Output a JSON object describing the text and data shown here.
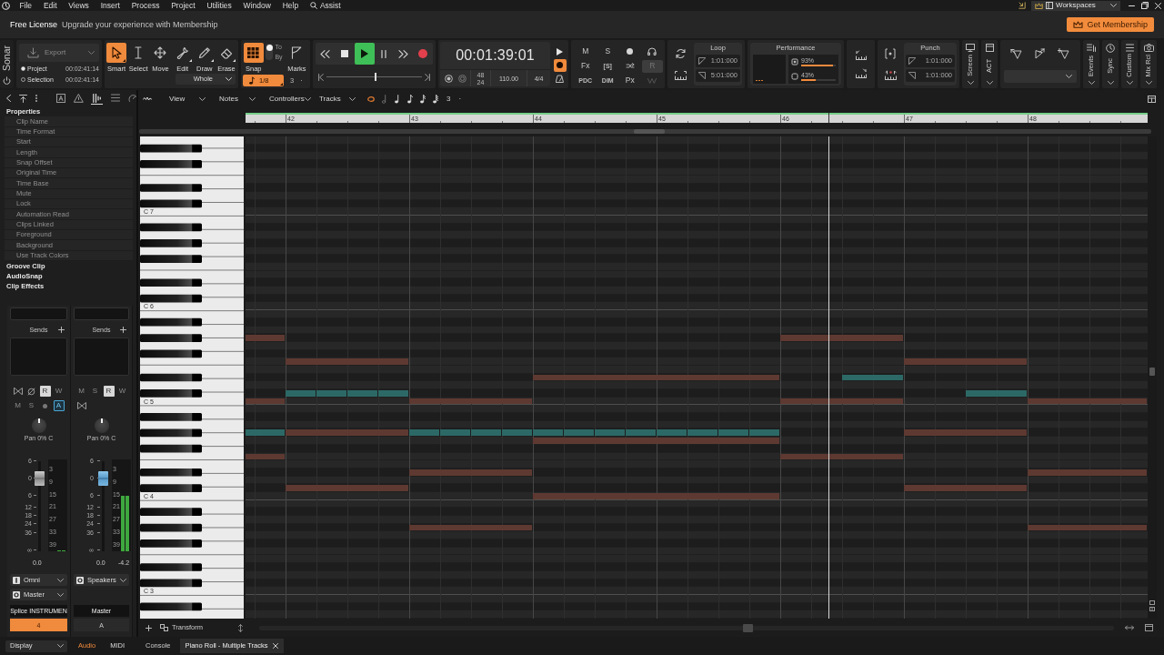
{
  "menubar": {
    "items": [
      "File",
      "Edit",
      "Views",
      "Insert",
      "Process",
      "Project",
      "Utilities",
      "Window",
      "Help"
    ],
    "assist": "Assist",
    "workspaces": "Workspaces"
  },
  "license": {
    "title": "Free License",
    "message": "Upgrade your experience with Membership",
    "button": "Get Membership"
  },
  "toolbar": {
    "logo": "Sonar",
    "export": {
      "label": "Export",
      "disabled": true,
      "options": [
        {
          "label": "Project",
          "time": "00:02:41:14",
          "selected": true
        },
        {
          "label": "Selection",
          "time": "00:02:41:14",
          "selected": false
        }
      ]
    },
    "tools": [
      {
        "kind": "smart",
        "label": "Smart",
        "selected": true,
        "has_menu": true
      },
      {
        "kind": "select",
        "label": "Select",
        "selected": false,
        "has_menu": false
      },
      {
        "kind": "move",
        "label": "Move",
        "selected": false,
        "has_menu": false
      },
      {
        "kind": "edit",
        "label": "Edit",
        "selected": false,
        "has_menu": true
      },
      {
        "kind": "draw",
        "label": "Draw",
        "selected": false,
        "has_menu": true
      },
      {
        "kind": "erase",
        "label": "Erase",
        "selected": false,
        "has_menu": true
      }
    ],
    "tool_mode": "Whole",
    "snap": {
      "label": "Snap",
      "on": true,
      "modes": [
        {
          "label": "To",
          "selected": true
        },
        {
          "label": "By",
          "selected": false
        }
      ],
      "marks": "Marks",
      "resolution": "1/8",
      "triplet": "3",
      "dotted": "·"
    },
    "transport": {
      "playing": true,
      "position": {
        "level": 0.51
      }
    },
    "clock": {
      "time": "00:01:39:01",
      "sample_rate": "48",
      "bit_depth": "24",
      "tempo": "110.00",
      "meter": "4/4",
      "record_mode": true
    },
    "mix_buttons": [
      {
        "label": "M",
        "on": false
      },
      {
        "label": "S",
        "on": false
      },
      {
        "label": "Fx",
        "on": false
      },
      {
        "label": "[S]",
        "on": false
      },
      {
        "label": "R",
        "on": true
      },
      {
        "label": "PDC",
        "on": false
      },
      {
        "label": "DIM",
        "on": false
      },
      {
        "label": "Px",
        "on": false
      }
    ],
    "loop": {
      "label": "Loop",
      "start": "1:01:000",
      "end": "5:01:000"
    },
    "performance": {
      "label": "Performance",
      "meters": [
        {
          "reading": "93%",
          "level": 0.93
        },
        {
          "reading": "43%",
          "level": 0.43
        }
      ]
    },
    "punch": {
      "label": "Punch",
      "start": "1:01:000",
      "end": "1:01:000"
    },
    "views_left": [
      "Screen",
      "ACT"
    ],
    "views_right": [
      "Events",
      "Sync",
      "Custom",
      "Mix Rcl"
    ]
  },
  "inspector": {
    "tabs": [
      {
        "selected": false
      },
      {
        "selected": false
      },
      {
        "selected": true
      },
      {
        "selected": false
      },
      {
        "selected": false
      }
    ],
    "title": "Properties",
    "properties": [
      "Clip Name",
      "Time Format",
      "Start",
      "Length",
      "Snap Offset",
      "Original Time",
      "Time Base",
      "Mute",
      "Lock",
      "Automation Read",
      "Clips Linked",
      "Foreground",
      "Background",
      "Use Track Colors"
    ],
    "sections": [
      "Groove Clip",
      "AudioSnap",
      "Clip Effects"
    ]
  },
  "strips": [
    {
      "kind": "track",
      "sends": "Sends",
      "buttons": [
        {
          "kind": "read",
          "label": "R",
          "on": true
        },
        {
          "kind": "write",
          "label": "W",
          "on": false
        },
        {
          "kind": "mute",
          "label": "M",
          "on": false
        },
        {
          "kind": "solo",
          "label": "S",
          "on": false
        },
        {
          "kind": "automation",
          "label": "A",
          "on": true
        }
      ],
      "pan": {
        "reading": "Pan 0% C",
        "level": 0.5
      },
      "fader": {
        "level": 0.81
      },
      "fader_scale": [
        "6",
        "0",
        "6",
        "12",
        "18",
        "24",
        "36",
        "∞"
      ],
      "meter_scale": [
        "3",
        "9",
        "15",
        "21",
        "27",
        "33",
        "39"
      ],
      "meters": [
        {
          "level": 0
        },
        {
          "level": 0
        }
      ],
      "fader_value": "0.0",
      "input": "Omni",
      "output": "Master",
      "name": "Splice INSTRUMEN",
      "number": "4",
      "color": "#f08a3c"
    },
    {
      "kind": "bus",
      "sends": "Sends",
      "buttons": [
        {
          "kind": "mute",
          "label": "M",
          "on": false
        },
        {
          "kind": "solo",
          "label": "S",
          "on": false
        },
        {
          "kind": "read",
          "label": "R",
          "on": true
        },
        {
          "kind": "write",
          "label": "W",
          "on": false
        }
      ],
      "pan": {
        "reading": "Pan 0% C",
        "level": 0.5
      },
      "fader": {
        "level": 0.81
      },
      "fader_scale": [
        "6",
        "0",
        "6",
        "12",
        "18",
        "24",
        "36",
        "∞"
      ],
      "meter_scale": [
        "3",
        "9",
        "15",
        "21",
        "27",
        "33",
        "39"
      ],
      "meters": [
        {
          "level": 0.6
        },
        {
          "level": 0.6
        }
      ],
      "fader_value": "0.0",
      "peak": "-4.2",
      "output": "Speakers",
      "name": "Master",
      "number": "A"
    }
  ],
  "console_footer": {
    "display": "Display",
    "tabs": [
      {
        "label": "Audio",
        "selected": true
      },
      {
        "label": "MIDI",
        "selected": false
      }
    ]
  },
  "piano_roll": {
    "menus": [
      "View",
      "Notes",
      "Controllers",
      "Tracks"
    ],
    "triplet": "3",
    "dotted": "·",
    "ruler": [
      "42",
      "43",
      "44",
      "45",
      "46",
      "47",
      "48"
    ],
    "octaves": [
      "C 7",
      "C 6",
      "C 5",
      "C 4",
      "C 3"
    ],
    "note_tracks": [
      {
        "color": "#5e3931"
      },
      {
        "color": "#2c6966"
      }
    ],
    "transform": "Transform"
  },
  "tabs": [
    {
      "label": "Console",
      "selected": false,
      "closable": false
    },
    {
      "label": "Piano Roll - Multiple Tracks",
      "selected": true,
      "closable": true
    }
  ]
}
